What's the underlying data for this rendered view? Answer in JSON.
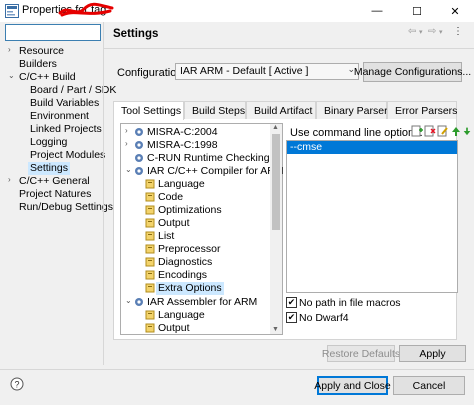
{
  "window": {
    "title": "Properties for tag",
    "controls": {
      "minimize": "—",
      "maximize": "☐",
      "close": "✕"
    }
  },
  "left_tree": {
    "filter_value": "",
    "items": [
      {
        "label": "Resource",
        "expander": "›"
      },
      {
        "label": "Builders",
        "expander": ""
      },
      {
        "label": "C/C++ Build",
        "expander": "⌄"
      },
      {
        "label": "Board / Part / SDK",
        "expander": ""
      },
      {
        "label": "Build Variables",
        "expander": ""
      },
      {
        "label": "Environment",
        "expander": ""
      },
      {
        "label": "Linked Projects",
        "expander": ""
      },
      {
        "label": "Logging",
        "expander": ""
      },
      {
        "label": "Project Modules",
        "expander": ""
      },
      {
        "label": "Settings",
        "expander": ""
      },
      {
        "label": "C/C++ General",
        "expander": "›"
      },
      {
        "label": "Project Natures",
        "expander": ""
      },
      {
        "label": "Run/Debug Settings",
        "expander": ""
      }
    ]
  },
  "header": {
    "title": "Settings",
    "nav": {
      "back": "⇦",
      "back_menu": "▾",
      "forward": "⇨",
      "forward_menu": "▾",
      "menu": "⋮"
    }
  },
  "configuration": {
    "label": "Configuration:",
    "value": "IAR ARM - Default  [ Active ]",
    "manage_label": "Manage Configurations..."
  },
  "tabs": [
    {
      "label": "Tool Settings"
    },
    {
      "label": "Build Steps"
    },
    {
      "label": "Build Artifact"
    },
    {
      "label": "Binary Parsers"
    },
    {
      "label": "Error Parsers"
    }
  ],
  "tool_tree": {
    "items": [
      {
        "label": "MISRA-C:2004",
        "expander": "›"
      },
      {
        "label": "MISRA-C:1998",
        "expander": "›"
      },
      {
        "label": "C-RUN Runtime Checking",
        "expander": ""
      },
      {
        "label": "IAR C/C++ Compiler for ARM",
        "expander": "⌄"
      },
      {
        "label": "Language",
        "expander": ""
      },
      {
        "label": "Code",
        "expander": ""
      },
      {
        "label": "Optimizations",
        "expander": ""
      },
      {
        "label": "Output",
        "expander": ""
      },
      {
        "label": "List",
        "expander": ""
      },
      {
        "label": "Preprocessor",
        "expander": ""
      },
      {
        "label": "Diagnostics",
        "expander": ""
      },
      {
        "label": "Encodings",
        "expander": ""
      },
      {
        "label": "Extra Options",
        "expander": ""
      },
      {
        "label": "IAR Assembler for ARM",
        "expander": "⌄"
      },
      {
        "label": "Language",
        "expander": ""
      },
      {
        "label": "Output",
        "expander": ""
      }
    ]
  },
  "options": {
    "label": "Use command line options:",
    "items": [
      "--cmse"
    ],
    "no_path_label": "No path in file macros",
    "no_path_checked": true,
    "no_dwarf_label": "No Dwarf4",
    "no_dwarf_checked": true,
    "check_glyph": "✔"
  },
  "buttons": {
    "restore_defaults": "Restore Defaults",
    "apply": "Apply",
    "apply_close": "Apply and Close",
    "cancel": "Cancel",
    "help": "?"
  },
  "colors": {
    "selection": "#0078d7",
    "tree_selected": "#cce8ff",
    "accent_red": "#e81123"
  }
}
